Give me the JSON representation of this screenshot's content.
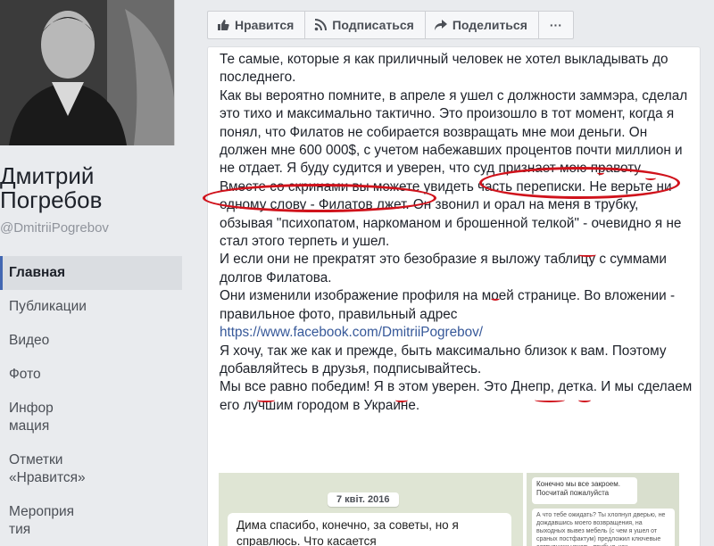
{
  "page": {
    "name_line1": "Дмитрий",
    "name_line2": "Погребов",
    "handle": "@DmitriiPogrebov"
  },
  "nav": [
    {
      "label": "Главная",
      "active": true
    },
    {
      "label": "Публикации"
    },
    {
      "label": "Видео"
    },
    {
      "label": "Фото"
    },
    {
      "label": "Информация"
    },
    {
      "label": "Отметки «Нравится»"
    },
    {
      "label": "Мероприятия"
    }
  ],
  "toolbar": {
    "like": "Нравится",
    "subscribe": "Подписаться",
    "share": "Поделиться",
    "more": "···"
  },
  "post": {
    "p1": "Те самые, которые я как приличный человек не хотел выкладывать до последнего.",
    "p2": "Как вы вероятно помните, в апреле я ушел с должности заммэра, сделал это тихо и максимально тактично. Это произошло в тот момент, когда я понял, что Филатов не собирается возвращать мне мои деньги. Он должен мне 600 000$, с учетом набежавших процентов почти миллион и не отдает. Я буду судится и уверен, что суд признает мою правоту.",
    "p3": "Вместе со скринами вы можете увидеть часть переписки. Не верьте ни одному слову - Филатов лжет. Он звонил и орал на меня в трубку, обзывая \"психопатом, наркоманом и брошенной телкой\" - очевидно я не стал этого терпеть и ушел.",
    "p4": "И если они не прекратят это безобразие я выложу таблицу с суммами долгов Филатова.",
    "p5": "Они изменили изображение профиля на моей странице. Во вложении - правильное фото, правильный адрес",
    "link": "https://www.facebook.com/DmitriiPogrebov/",
    "p6": "Я хочу, так же как и прежде, быть максимально близок к вам. Поэтому добавляйтесь в друзья, подписывайтесь.",
    "p7": "Мы все равно победим! Я в этом уверен. Это Днепр, детка. И мы сделаем его лучшим городом в Украине."
  },
  "attachments": {
    "date": "7 квіт. 2016",
    "msg1": "Дима спасибо, конечно, за советы, но я справлюсь. Что касается",
    "msg2": "Конечно мы все закроем. Посчитай пожалуйста",
    "msg3": "А что тебе ожидать? Ты хлопнул дверью, не дождавшись моего возвращения, на выходных вывез мебель (с чем я ушел от сраных постфактум) предложил ключевые сотрудники уехать. прибыл, как"
  },
  "colors": {
    "annotation": "#d0121b",
    "link": "#365899",
    "nav_active_border": "#4267b2"
  }
}
